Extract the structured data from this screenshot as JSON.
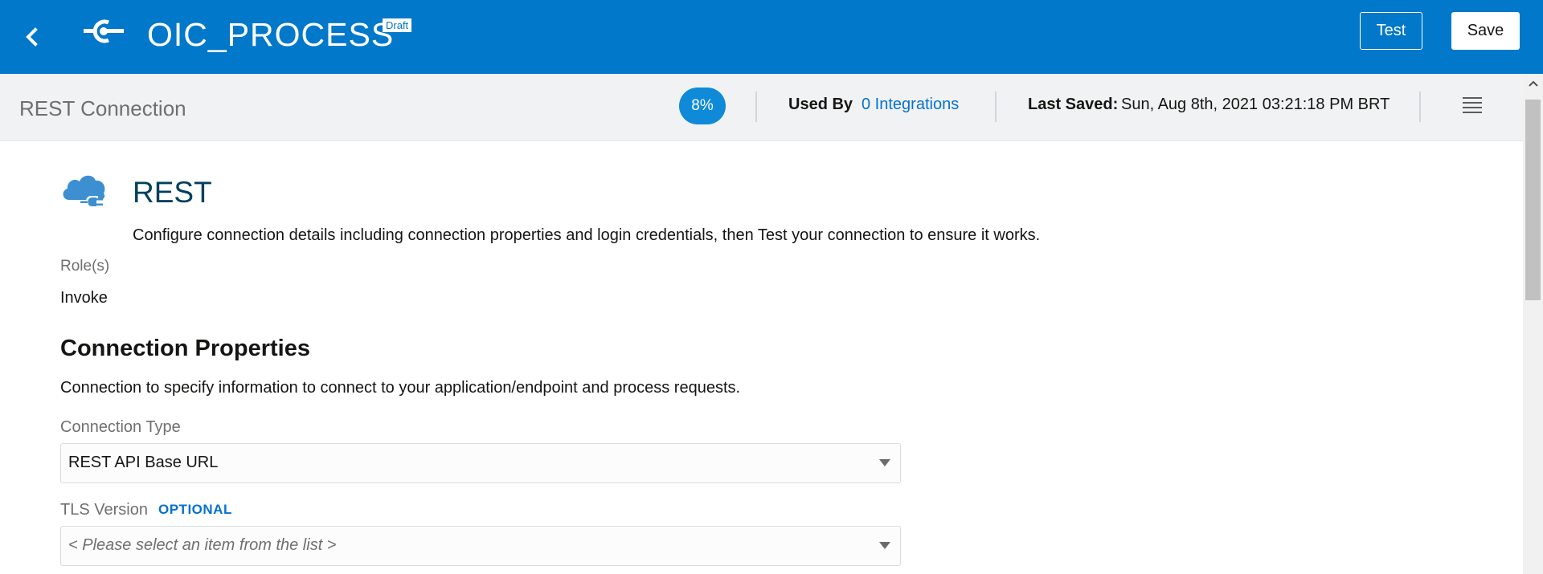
{
  "header": {
    "title": "OIC_PROCESS",
    "status_badge": "Draft",
    "test_label": "Test",
    "save_label": "Save"
  },
  "subheader": {
    "title": "REST Connection",
    "progress_label": "8%",
    "progress_value": 8,
    "used_by_label": "Used By",
    "used_by_link": "0 Integrations",
    "last_saved_label": "Last Saved:",
    "last_saved_value": "Sun, Aug 8th, 2021 03:21:18 PM BRT"
  },
  "connector": {
    "icon": "cloud-plug-icon",
    "name": "REST",
    "description": "Configure connection details including connection properties and login credentials, then Test your connection to ensure it works.",
    "roles_label": "Role(s)",
    "roles_value": "Invoke"
  },
  "connection_properties": {
    "title": "Connection Properties",
    "description": "Connection to specify information to connect to your application/endpoint and process requests.",
    "fields": [
      {
        "label": "Connection Type",
        "value": "REST API Base URL"
      },
      {
        "label": "TLS Version",
        "tag": "OPTIONAL",
        "placeholder": "< Please select an item from the list >"
      }
    ]
  },
  "colors": {
    "brand_header": "#0178c9",
    "link": "#0572ce",
    "progress_badge": "#0f8ad8",
    "heading_dark": "#003f5e"
  }
}
